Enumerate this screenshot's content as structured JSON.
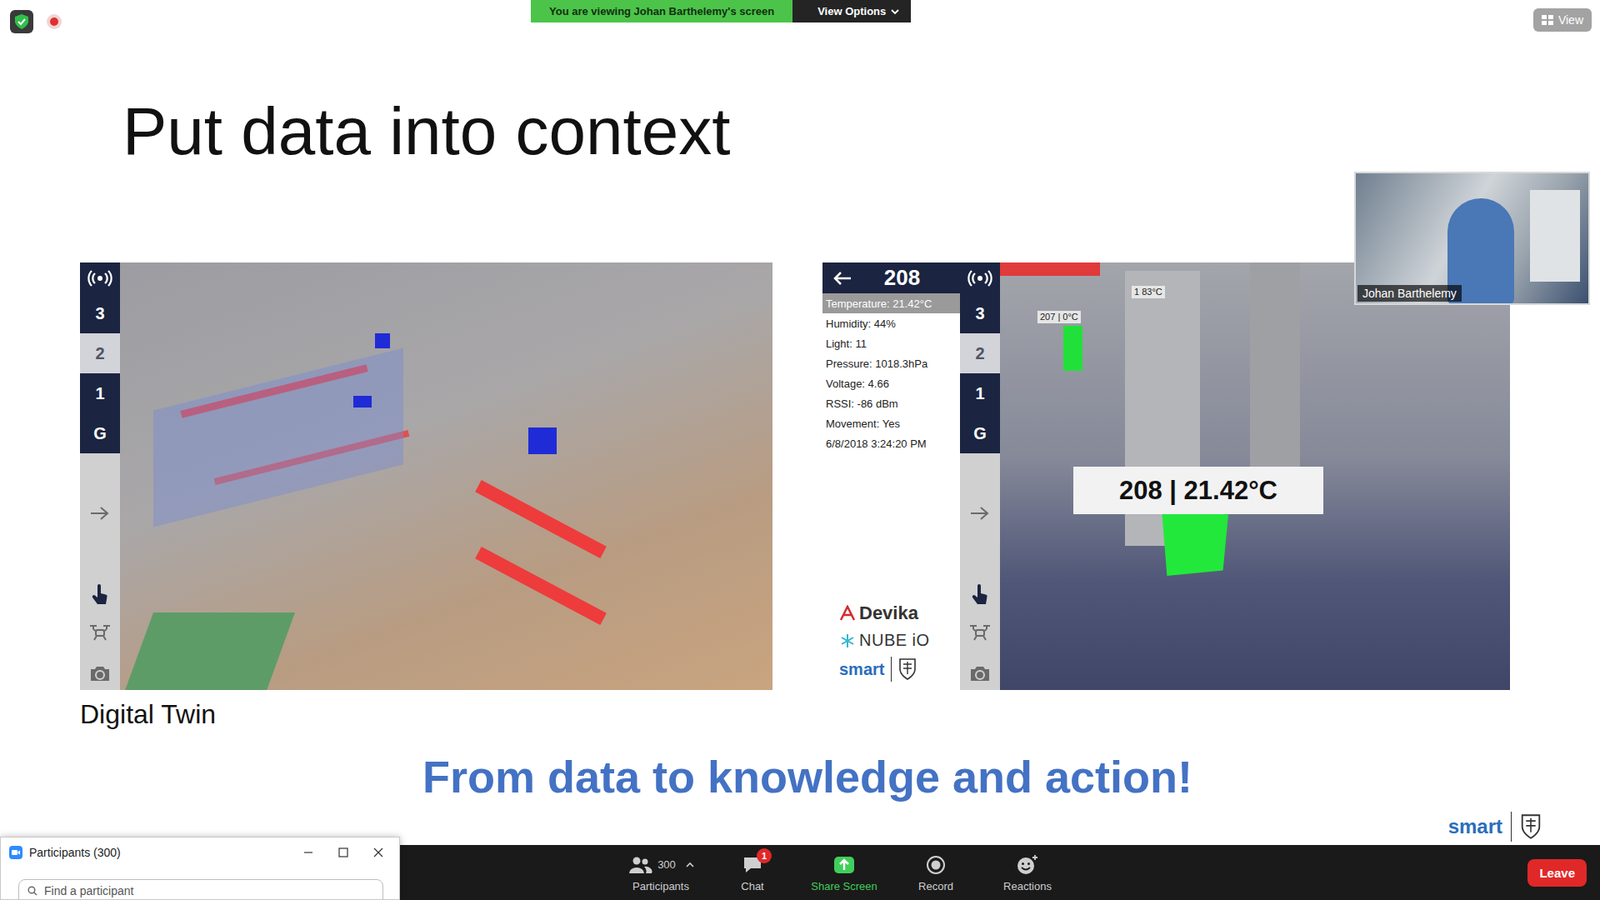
{
  "meeting_banner": {
    "text": "You are viewing Johan Barthelemy's screen",
    "options": "View Options"
  },
  "view_button": {
    "label": "View"
  },
  "slide": {
    "title": "Put data into context",
    "left_panel": {
      "floors": [
        {
          "label": "3",
          "selected": false
        },
        {
          "label": "2",
          "selected": true
        },
        {
          "label": "1",
          "selected": false
        },
        {
          "label": "G",
          "selected": false
        }
      ],
      "caption": "Digital Twin"
    },
    "right_panel": {
      "room": "208",
      "readings": [
        {
          "text": "Temperature: 21.42°C",
          "selected": true
        },
        {
          "text": "Humidity: 44%",
          "selected": false
        },
        {
          "text": "Light: 11",
          "selected": false
        },
        {
          "text": "Pressure: 1018.3hPa",
          "selected": false
        },
        {
          "text": "Voltage: 4.66",
          "selected": false
        },
        {
          "text": "RSSI: -86 dBm",
          "selected": false
        },
        {
          "text": "Movement: Yes",
          "selected": false
        },
        {
          "text": "6/8/2018 3:24:20 PM",
          "selected": false
        }
      ],
      "logos": {
        "devika": "Devika",
        "nube": "NUBE iO",
        "smart": "smart"
      },
      "floors": [
        {
          "label": "3",
          "selected": false
        },
        {
          "label": "2",
          "selected": true
        },
        {
          "label": "1",
          "selected": false
        },
        {
          "label": "G",
          "selected": false
        }
      ],
      "scene_label": "208 | 21.42°C",
      "small_labels": [
        "207 | 0°C",
        "1 83°C"
      ]
    },
    "tagline": "From data to knowledge and action!",
    "footer_logo": "smart"
  },
  "video": {
    "name": "Johan Barthelemy"
  },
  "participants_window": {
    "title": "Participants (300)",
    "search": {
      "placeholder": "Find a participant"
    }
  },
  "toolbar": {
    "items": [
      {
        "kind": "participants",
        "label": "Participants",
        "count": "300",
        "badge": "",
        "color": "#cfcfcf"
      },
      {
        "kind": "chat",
        "label": "Chat",
        "count": "",
        "badge": "1",
        "color": "#cfcfcf"
      },
      {
        "kind": "share",
        "label": "Share Screen",
        "count": "",
        "badge": "",
        "color": "#3fcf5a"
      },
      {
        "kind": "record",
        "label": "Record",
        "count": "",
        "badge": "",
        "color": "#cfcfcf"
      },
      {
        "kind": "reactions",
        "label": "Reactions",
        "count": "",
        "badge": "",
        "color": "#cfcfcf"
      }
    ],
    "leave": "Leave"
  }
}
